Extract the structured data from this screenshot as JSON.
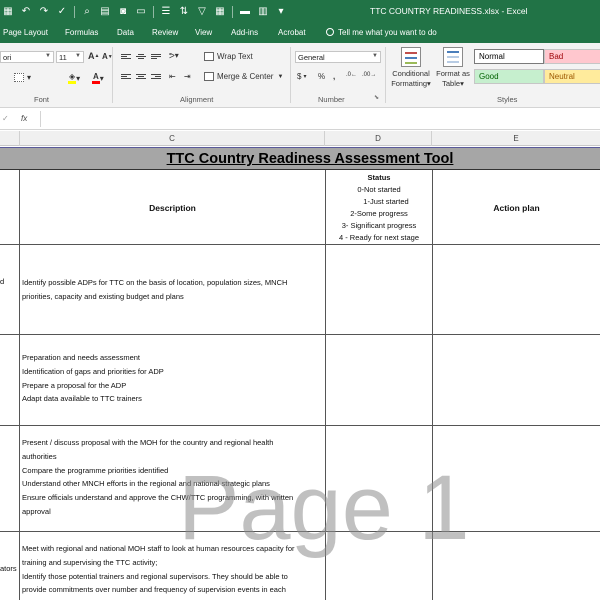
{
  "window": {
    "title": "TTC COUNTRY READINESS.xlsx - Excel"
  },
  "ribbon_tabs": [
    "Page Layout",
    "Formulas",
    "Data",
    "Review",
    "View",
    "Add-ins",
    "Acrobat"
  ],
  "tell_me": "Tell me what you want to do",
  "font_group": {
    "font_name": "ori",
    "font_size": "11",
    "label": "Font"
  },
  "alignment_group": {
    "wrap_text": "Wrap Text",
    "merge_center": "Merge & Center",
    "label": "Alignment"
  },
  "number_group": {
    "format": "General",
    "currency_symbol": "$",
    "percent_symbol": "%",
    "comma_symbol": ",",
    "label": "Number"
  },
  "styles_group": {
    "conditional_formatting": [
      "Conditional",
      "Formatting"
    ],
    "format_as_table": [
      "Format as",
      "Table"
    ],
    "label": "Styles",
    "cell_styles": [
      {
        "name": "Normal",
        "bg": "#ffffff",
        "fg": "#000000"
      },
      {
        "name": "Bad",
        "bg": "#ffc7ce",
        "fg": "#9c0006"
      },
      {
        "name": "Good",
        "bg": "#c6efce",
        "fg": "#006100"
      },
      {
        "name": "Neutral",
        "bg": "#ffeb9c",
        "fg": "#9c5700"
      }
    ]
  },
  "formula_bar": {
    "fx": "fx",
    "value": ""
  },
  "column_headers": [
    "C",
    "D",
    "E"
  ],
  "sheet": {
    "title": "TTC Country Readiness Assessment Tool",
    "headers": {
      "description": "Description",
      "action_plan": "Action plan"
    },
    "status": {
      "heading": "Status",
      "levels": [
        "0-Not started",
        "1-Just started",
        "2-Some progress",
        "3- Significant progress",
        "4 - Ready for next stage"
      ]
    },
    "left_fragments": [
      "d",
      "ators"
    ],
    "rows": [
      {
        "lines": [
          "Identify possible ADPs for TTC on the basis of location, population sizes, MNCH",
          "priorities, capacity and existing budget and plans"
        ]
      },
      {
        "lines": [
          "Preparation and needs assessment",
          "Identification of gaps and priorities for ADP",
          "Prepare a  proposal for the ADP",
          "Adapt data available to TTC trainers"
        ]
      },
      {
        "lines": [
          "Present  / discuss proposal with the MOH for the country and regional health",
          "authorities",
          "Compare the programme priorities identified",
          "Understand other MNCH efforts in the regional and national strategic plans",
          "Ensure officials understand and approve the CHW/TTC programming, with written",
          "approval"
        ]
      },
      {
        "lines": [
          "Meet with regional and national MOH staff to look at human resources capacity for",
          "training and supervising the TTC activity;",
          "Identify those potential trainers and regional supervisors. They should be able to",
          "provide commitments over  number and frequency of supervision events in each"
        ]
      }
    ]
  },
  "watermark": "Page 1",
  "colors": {
    "excel_green": "#217346",
    "title_row_bg": "#a6a6a6"
  }
}
